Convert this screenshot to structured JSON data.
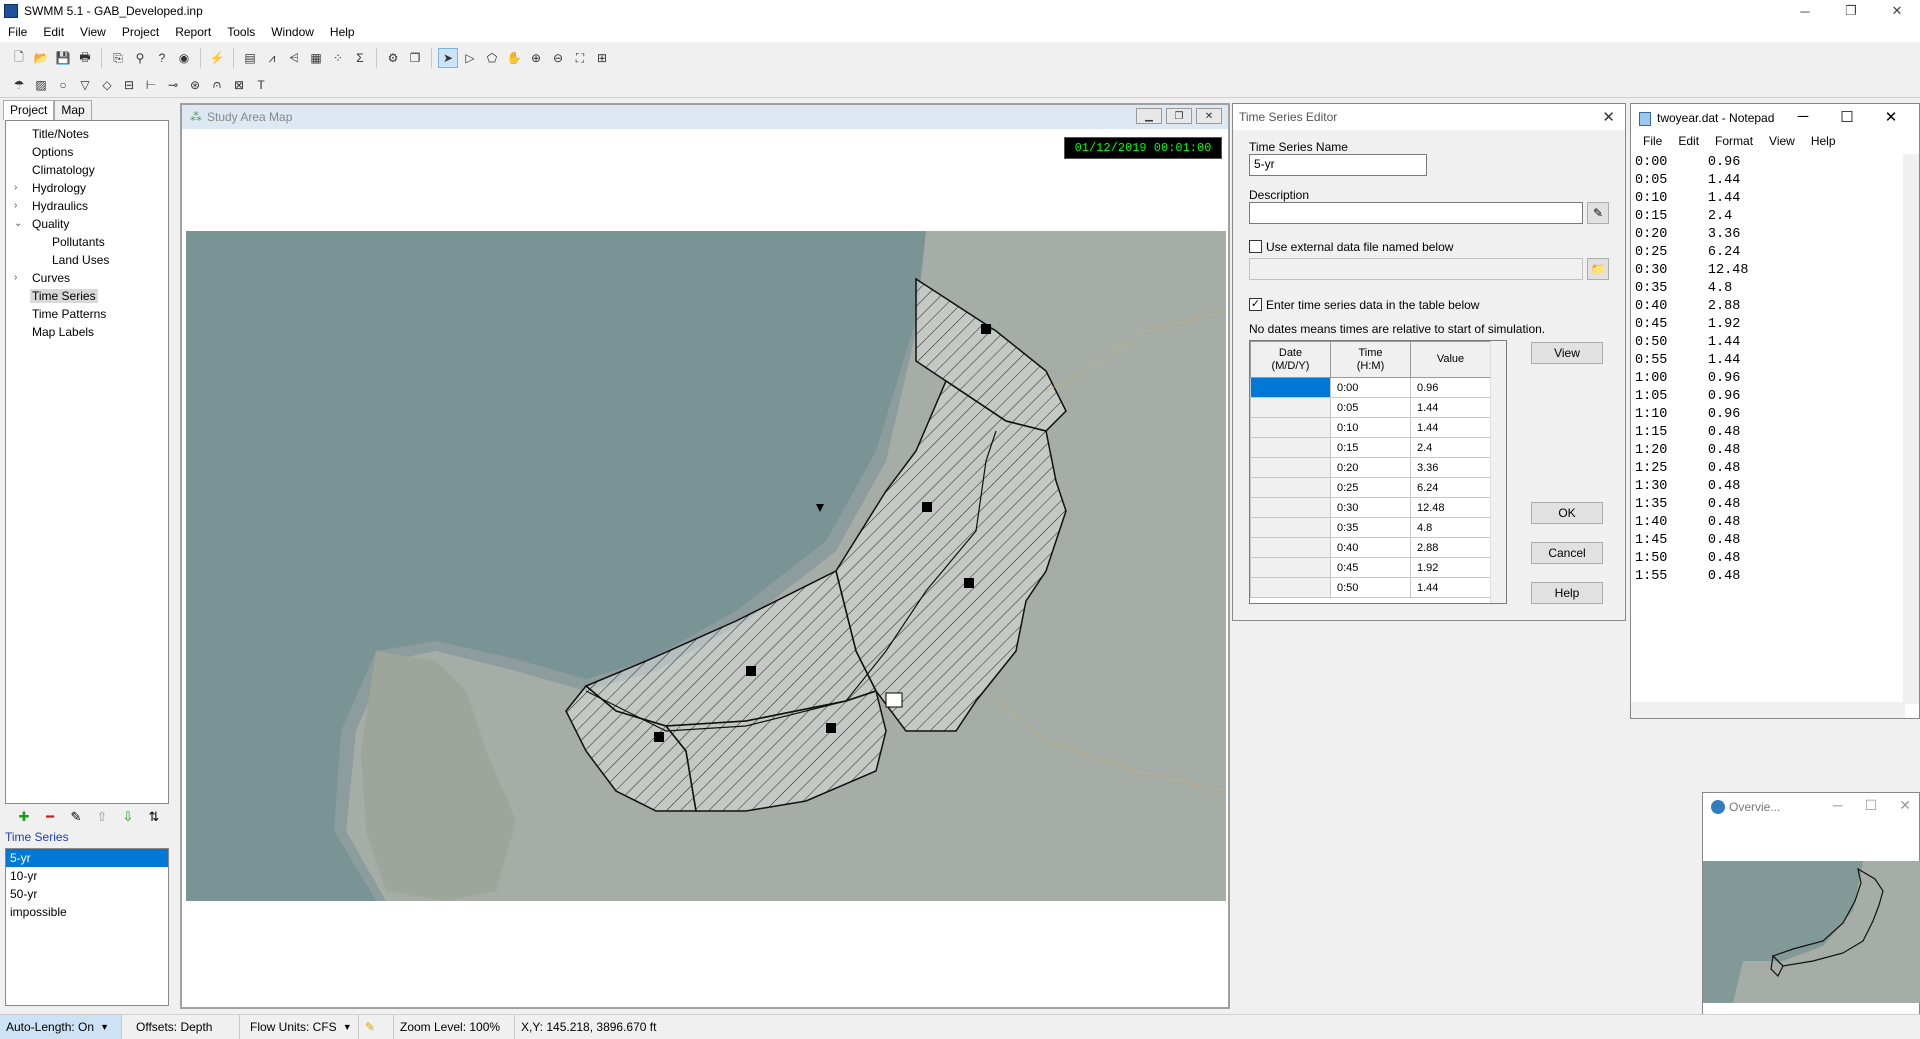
{
  "app": {
    "window_title": "SWMM 5.1 - GAB_Developed.inp",
    "menu": [
      "File",
      "Edit",
      "View",
      "Project",
      "Report",
      "Tools",
      "Window",
      "Help"
    ]
  },
  "left_panel": {
    "tabs": [
      "Project",
      "Map"
    ],
    "tree": [
      {
        "label": "Title/Notes",
        "expander": ""
      },
      {
        "label": "Options",
        "expander": ""
      },
      {
        "label": "Climatology",
        "expander": ""
      },
      {
        "label": "Hydrology",
        "expander": "›"
      },
      {
        "label": "Hydraulics",
        "expander": "›"
      },
      {
        "label": "Quality",
        "expander": "⌄"
      },
      {
        "label": "Pollutants",
        "expander": ""
      },
      {
        "label": "Land Uses",
        "expander": ""
      },
      {
        "label": "Curves",
        "expander": "›"
      },
      {
        "label": "Time Series",
        "expander": ""
      },
      {
        "label": "Time Patterns",
        "expander": ""
      },
      {
        "label": "Map Labels",
        "expander": ""
      }
    ],
    "object_type_title": "Time Series",
    "objects": [
      "5-yr",
      "10-yr",
      "50-yr",
      "impossible"
    ],
    "selected_object": "5-yr"
  },
  "map_window": {
    "title": "Study Area Map",
    "datetime": "01/12/2019 00:01:00"
  },
  "ts_editor": {
    "title": "Time Series Editor",
    "name_label": "Time Series Name",
    "name_value": "5-yr",
    "description_label": "Description",
    "description_value": "",
    "external_label": "Use external data file named below",
    "external_checked": false,
    "table_label": "Enter time series data in the table below",
    "table_checked": true,
    "note": "No dates means times are relative to start of simulation.",
    "columns": [
      "Date\n(M/D/Y)",
      "Time\n(H:M)",
      "Value"
    ],
    "rows": [
      {
        "date": "",
        "time": "0:00",
        "value": "0.96"
      },
      {
        "date": "",
        "time": "0:05",
        "value": "1.44"
      },
      {
        "date": "",
        "time": "0:10",
        "value": "1.44"
      },
      {
        "date": "",
        "time": "0:15",
        "value": "2.4"
      },
      {
        "date": "",
        "time": "0:20",
        "value": "3.36"
      },
      {
        "date": "",
        "time": "0:25",
        "value": "6.24"
      },
      {
        "date": "",
        "time": "0:30",
        "value": "12.48"
      },
      {
        "date": "",
        "time": "0:35",
        "value": "4.8"
      },
      {
        "date": "",
        "time": "0:40",
        "value": "2.88"
      },
      {
        "date": "",
        "time": "0:45",
        "value": "1.92"
      },
      {
        "date": "",
        "time": "0:50",
        "value": "1.44"
      }
    ],
    "buttons": {
      "view": "View",
      "ok": "OK",
      "cancel": "Cancel",
      "help": "Help"
    }
  },
  "notepad": {
    "title": "twoyear.dat - Notepad",
    "menu": [
      "File",
      "Edit",
      "Format",
      "View",
      "Help"
    ],
    "content": "0:00     0.96\n0:05     1.44\n0:10     1.44\n0:15     2.4\n0:20     3.36\n0:25     6.24\n0:30     12.48\n0:35     4.8\n0:40     2.88\n0:45     1.92\n0:50     1.44\n0:55     1.44\n1:00     0.96\n1:05     0.96\n1:10     0.96\n1:15     0.48\n1:20     0.48\n1:25     0.48\n1:30     0.48\n1:35     0.48\n1:40     0.48\n1:45     0.48\n1:50     0.48\n1:55     0.48"
  },
  "overview": {
    "title": "Overvie..."
  },
  "status_bar": {
    "auto_length": "Auto-Length: On",
    "offsets": "Offsets: Depth",
    "flow_units": "Flow Units: CFS",
    "zoom": "Zoom Level: 100%",
    "xy": "X,Y: 145.218, 3896.670 ft"
  },
  "colors": {
    "accent": "#0078d7",
    "clock_text": "#00ff00",
    "object_title": "#1a3dbd"
  }
}
